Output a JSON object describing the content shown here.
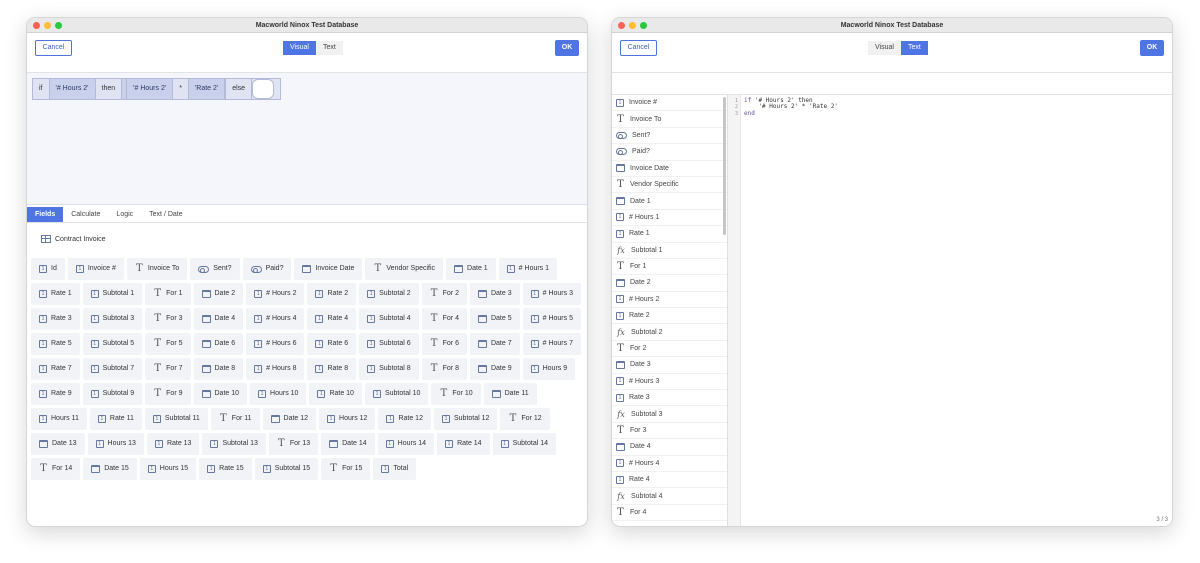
{
  "window_title": "Macworld Ninox Test Database",
  "left": {
    "cancel_label": "Cancel",
    "ok_label": "OK",
    "mode_visual": "Visual",
    "mode_text": "Text",
    "expression": {
      "if_kw": "if",
      "cond_field": "'# Hours 2'",
      "then_kw": "then",
      "mul_field_a": "'# Hours 2'",
      "mul_op": "*",
      "mul_field_b": "'Rate 2'",
      "else_kw": "else"
    },
    "tabs": [
      "Fields",
      "Calculate",
      "Logic",
      "Text / Date"
    ],
    "group_title": "Contract Invoice",
    "chips": [
      {
        "label": "Id",
        "icon": "number"
      },
      {
        "label": "Invoice #",
        "icon": "number"
      },
      {
        "label": "Invoice To",
        "icon": "text"
      },
      {
        "label": "Sent?",
        "icon": "boolean"
      },
      {
        "label": "Paid?",
        "icon": "boolean"
      },
      {
        "label": "Invoice Date",
        "icon": "date"
      },
      {
        "label": "Vendor Specific",
        "icon": "text"
      },
      {
        "label": "Date 1",
        "icon": "date"
      },
      {
        "label": "# Hours 1",
        "icon": "number"
      },
      {
        "label": "Rate 1",
        "icon": "number"
      },
      {
        "label": "Subtotal 1",
        "icon": "number"
      },
      {
        "label": "For 1",
        "icon": "text"
      },
      {
        "label": "Date 2",
        "icon": "date"
      },
      {
        "label": "# Hours 2",
        "icon": "number"
      },
      {
        "label": "Rate 2",
        "icon": "number"
      },
      {
        "label": "Subtotal 2",
        "icon": "number"
      },
      {
        "label": "For 2",
        "icon": "text"
      },
      {
        "label": "Date 3",
        "icon": "date"
      },
      {
        "label": "# Hours 3",
        "icon": "number"
      },
      {
        "label": "Rate 3",
        "icon": "number"
      },
      {
        "label": "Subtotal 3",
        "icon": "number"
      },
      {
        "label": "For 3",
        "icon": "text"
      },
      {
        "label": "Date 4",
        "icon": "date"
      },
      {
        "label": "# Hours 4",
        "icon": "number"
      },
      {
        "label": "Rate 4",
        "icon": "number"
      },
      {
        "label": "Subtotal 4",
        "icon": "number"
      },
      {
        "label": "For 4",
        "icon": "text"
      },
      {
        "label": "Date 5",
        "icon": "date"
      },
      {
        "label": "# Hours 5",
        "icon": "number"
      },
      {
        "label": "Rate 5",
        "icon": "number"
      },
      {
        "label": "Subtotal 5",
        "icon": "number"
      },
      {
        "label": "For 5",
        "icon": "text"
      },
      {
        "label": "Date 6",
        "icon": "date"
      },
      {
        "label": "# Hours 6",
        "icon": "number"
      },
      {
        "label": "Rate 6",
        "icon": "number"
      },
      {
        "label": "Subtotal 6",
        "icon": "number"
      },
      {
        "label": "For 6",
        "icon": "text"
      },
      {
        "label": "Date 7",
        "icon": "date"
      },
      {
        "label": "# Hours 7",
        "icon": "number"
      },
      {
        "label": "Rate 7",
        "icon": "number"
      },
      {
        "label": "Subtotal 7",
        "icon": "number"
      },
      {
        "label": "For 7",
        "icon": "text"
      },
      {
        "label": "Date 8",
        "icon": "date"
      },
      {
        "label": "# Hours 8",
        "icon": "number"
      },
      {
        "label": "Rate 8",
        "icon": "number"
      },
      {
        "label": "Subtotal 8",
        "icon": "number"
      },
      {
        "label": "For 8",
        "icon": "text"
      },
      {
        "label": "Date 9",
        "icon": "date"
      },
      {
        "label": "Hours 9",
        "icon": "number"
      },
      {
        "label": "Rate 9",
        "icon": "number"
      },
      {
        "label": "Subtotal 9",
        "icon": "number"
      },
      {
        "label": "For 9",
        "icon": "text"
      },
      {
        "label": "Date 10",
        "icon": "date"
      },
      {
        "label": "Hours 10",
        "icon": "number"
      },
      {
        "label": "Rate 10",
        "icon": "number"
      },
      {
        "label": "Subtotal 10",
        "icon": "number"
      },
      {
        "label": "For 10",
        "icon": "text"
      },
      {
        "label": "Date 11",
        "icon": "date"
      },
      {
        "label": "Hours 11",
        "icon": "number"
      },
      {
        "label": "Rate 11",
        "icon": "number"
      },
      {
        "label": "Subtotal 11",
        "icon": "number"
      },
      {
        "label": "For 11",
        "icon": "text"
      },
      {
        "label": "Date 12",
        "icon": "date"
      },
      {
        "label": "Hours 12",
        "icon": "number"
      },
      {
        "label": "Rate 12",
        "icon": "number"
      },
      {
        "label": "Subtotal 12",
        "icon": "number"
      },
      {
        "label": "For 12",
        "icon": "text"
      },
      {
        "label": "Date 13",
        "icon": "date"
      },
      {
        "label": "Hours 13",
        "icon": "number"
      },
      {
        "label": "Rate 13",
        "icon": "number"
      },
      {
        "label": "Subtotal 13",
        "icon": "number"
      },
      {
        "label": "For 13",
        "icon": "text"
      },
      {
        "label": "Date 14",
        "icon": "date"
      },
      {
        "label": "Hours 14",
        "icon": "number"
      },
      {
        "label": "Rate 14",
        "icon": "number"
      },
      {
        "label": "Subtotal 14",
        "icon": "number"
      },
      {
        "label": "For 14",
        "icon": "text"
      },
      {
        "label": "Date 15",
        "icon": "date"
      },
      {
        "label": "Hours 15",
        "icon": "number"
      },
      {
        "label": "Rate 15",
        "icon": "number"
      },
      {
        "label": "Subtotal 15",
        "icon": "number"
      },
      {
        "label": "For 15",
        "icon": "text"
      },
      {
        "label": "Total",
        "icon": "number"
      }
    ]
  },
  "right": {
    "cancel_label": "Cancel",
    "ok_label": "OK",
    "mode_visual": "Visual",
    "mode_text": "Text",
    "fields": [
      {
        "label": "Invoice #",
        "icon": "number"
      },
      {
        "label": "Invoice To",
        "icon": "text"
      },
      {
        "label": "Sent?",
        "icon": "boolean"
      },
      {
        "label": "Paid?",
        "icon": "boolean"
      },
      {
        "label": "Invoice Date",
        "icon": "date"
      },
      {
        "label": "Vendor Specific",
        "icon": "text"
      },
      {
        "label": "Date 1",
        "icon": "date"
      },
      {
        "label": "# Hours 1",
        "icon": "number"
      },
      {
        "label": "Rate 1",
        "icon": "number"
      },
      {
        "label": "Subtotal 1",
        "icon": "formula"
      },
      {
        "label": "For 1",
        "icon": "text"
      },
      {
        "label": "Date 2",
        "icon": "date"
      },
      {
        "label": "# Hours 2",
        "icon": "number"
      },
      {
        "label": "Rate 2",
        "icon": "number"
      },
      {
        "label": "Subtotal 2",
        "icon": "formula"
      },
      {
        "label": "For 2",
        "icon": "text"
      },
      {
        "label": "Date 3",
        "icon": "date"
      },
      {
        "label": "# Hours 3",
        "icon": "number"
      },
      {
        "label": "Rate 3",
        "icon": "number"
      },
      {
        "label": "Subtotal 3",
        "icon": "formula"
      },
      {
        "label": "For 3",
        "icon": "text"
      },
      {
        "label": "Date 4",
        "icon": "date"
      },
      {
        "label": "# Hours 4",
        "icon": "number"
      },
      {
        "label": "Rate 4",
        "icon": "number"
      },
      {
        "label": "Subtotal 4",
        "icon": "formula"
      },
      {
        "label": "For 4",
        "icon": "text"
      }
    ],
    "code_lines": [
      {
        "num": "1",
        "kw": "if",
        "rest": " '# Hours 2' then"
      },
      {
        "num": "2",
        "kw": "",
        "rest": "    '# Hours 2' * 'Rate 2'"
      },
      {
        "num": "3",
        "kw": "end",
        "rest": ""
      }
    ],
    "page_indicator": "3 / 3"
  }
}
